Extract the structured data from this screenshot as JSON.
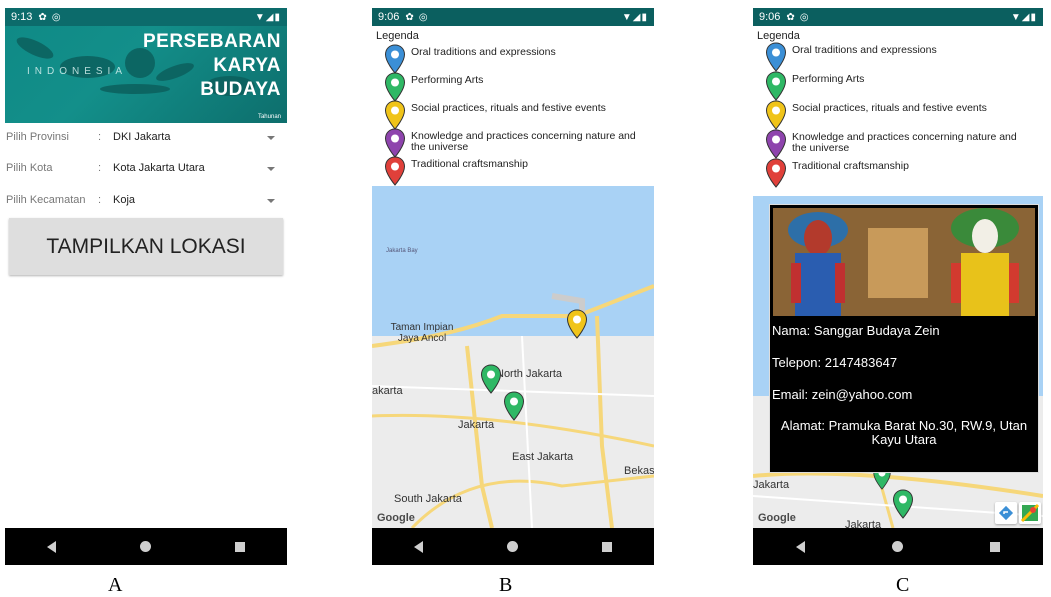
{
  "screens": {
    "a": {
      "status": {
        "time": "9:13"
      },
      "banner": {
        "line1": "PERSEBARAN",
        "line2": "KARYA",
        "line3": "BUDAYA",
        "watermark": "INDONESIA",
        "small": "Tahunan"
      },
      "form": [
        {
          "label": "Pilih Provinsi",
          "value": "DKI Jakarta"
        },
        {
          "label": "Pilih Kota",
          "value": "Kota Jakarta Utara"
        },
        {
          "label": "Pilih Kecamatan",
          "value": "Koja"
        }
      ],
      "button": "TAMPILKAN LOKASI"
    },
    "b": {
      "status": {
        "time": "9:06"
      },
      "legend_title": "Legenda",
      "map_labels": {
        "bay": "Jakarta Bay",
        "ancol": "Taman Impian Jaya Ancol",
        "north": "North Jakarta",
        "jakarta_left": "akarta",
        "jakarta": "Jakarta",
        "east": "East Jakarta",
        "bekasi": "Bekas",
        "south": "South Jakarta",
        "google": "Google"
      }
    },
    "c": {
      "status": {
        "time": "9:06"
      },
      "legend_title": "Legenda",
      "info": {
        "name": "Nama: Sanggar Budaya Zein",
        "phone": "Telepon: 2147483647",
        "email": "Email: zein@yahoo.com",
        "address": "Alamat: Pramuka Barat No.30, RW.9, Utan Kayu Utara"
      },
      "map_labels": {
        "jakarta_left": "Jakarta",
        "jakarta_bottom": "Jakarta",
        "google": "Google"
      }
    }
  },
  "legend_items": [
    {
      "label": "Oral traditions and expressions",
      "color": "#3b8fd6"
    },
    {
      "label": "Performing Arts",
      "color": "#2fb865"
    },
    {
      "label": "Social practices, rituals and festive events",
      "color": "#f0c419"
    },
    {
      "label": "Knowledge and practices concerning nature and the universe",
      "color": "#8e44ad"
    },
    {
      "label": "Traditional craftsmanship",
      "color": "#e0403a"
    }
  ],
  "captions": {
    "a": "A",
    "b": "B",
    "c": "C"
  }
}
